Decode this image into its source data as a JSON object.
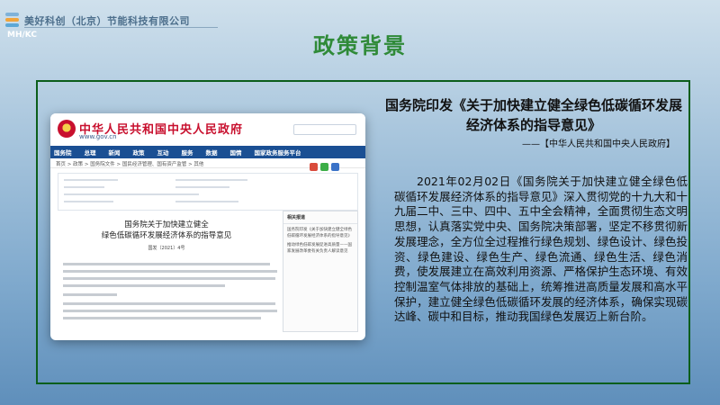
{
  "header": {
    "company": "美好科创（北京）节能科技有限公司",
    "corner_code": "MH/KC",
    "title": "政策背景",
    "logo_colors": [
      "#7fb2d9",
      "#f2a43a",
      "#5da8d6"
    ]
  },
  "screenshot": {
    "site_name": "中华人民共和国中央人民政府",
    "site_url": "www.gov.cn",
    "nav": [
      "国务院",
      "总理",
      "新闻",
      "政策",
      "互动",
      "服务",
      "数据",
      "国情",
      "国家政务服务平台"
    ],
    "breadcrumb": "首页 > 政策 > 国务院文件 > 国民经济管理、国有资产监管 > 其他",
    "article_title": "国务院关于加快建立健全\n绿色低碳循环发展经济体系的指导意见",
    "article_no": "国发〔2021〕4号",
    "sidebar_heading": "相关报道",
    "sidebar_items": [
      "国务院印发《关于加快建立健全绿色低碳循环发展经济体系的指导意见》",
      "推动绿色低碳发展促进高质量——国家发展改革委有关负责人解读意见"
    ],
    "share_colors": [
      "#d94b3c",
      "#3cae47",
      "#3b73c8"
    ]
  },
  "headline": "国务院印发《关于加快建立健全绿色低碳循环发展经济体系的指导意见》",
  "source": "——【中华人民共和国中央人民政府】",
  "body": "2021年02月02日《国务院关于加快建立健全绿色低碳循环发展经济体系的指导意见》深入贯彻党的十九大和十九届二中、三中、四中、五中全会精神，全面贯彻生态文明思想，认真落实党中央、国务院决策部署，坚定不移贯彻新发展理念，全方位全过程推行绿色规划、绿色设计、绿色投资、绿色建设、绿色生产、绿色流通、绿色生活、绿色消费，使发展建立在高效利用资源、严格保护生态环境、有效控制温室气体排放的基础上，统筹推进高质量发展和高水平保护，建立健全绿色低碳循环发展的经济体系，确保实现碳达峰、碳中和目标，推动我国绿色发展迈上新台阶。",
  "colors": {
    "title_green": "#2f8a38",
    "frame_green": "#0b5e1b",
    "gov_red": "#c8102e",
    "gov_blue": "#1a4f93"
  }
}
